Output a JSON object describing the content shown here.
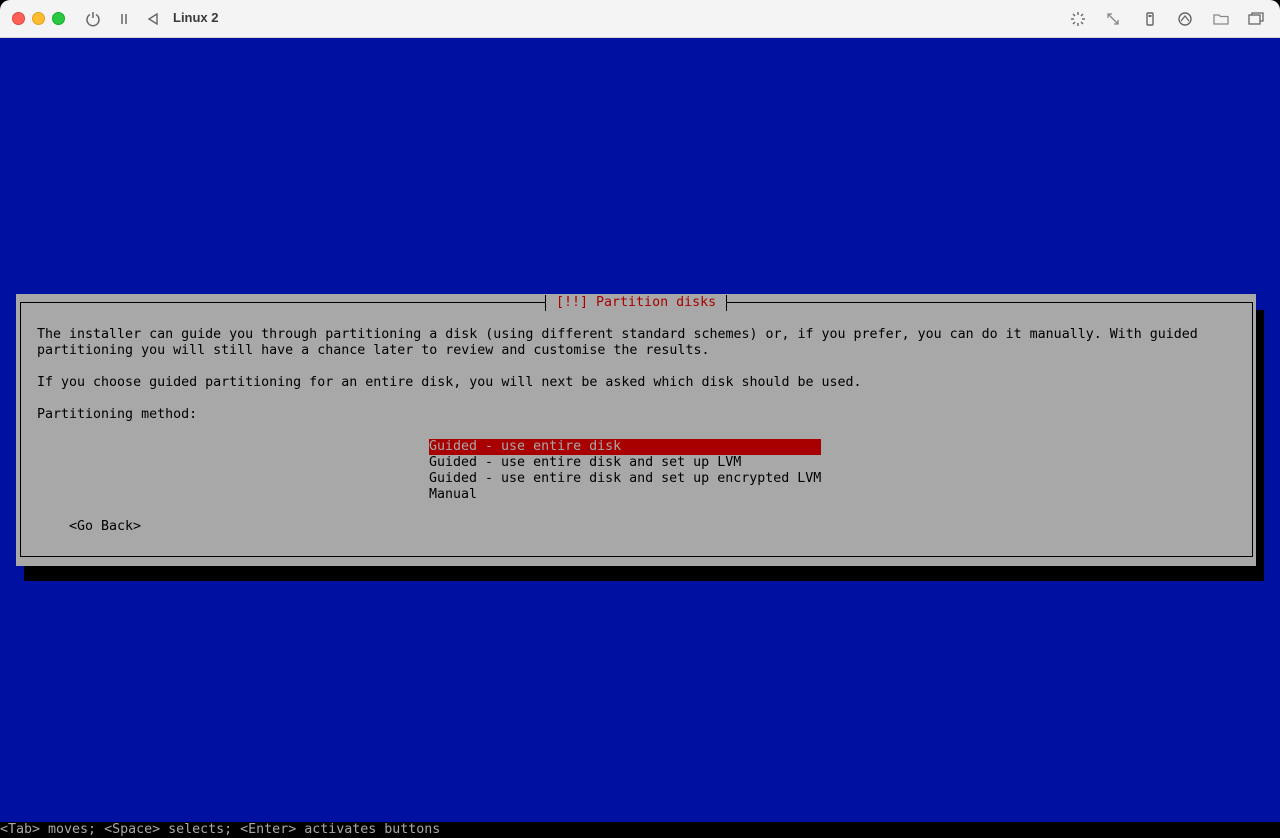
{
  "window": {
    "title": "Linux 2",
    "icons": [
      "power-icon",
      "pause-icon",
      "back-icon",
      "brightness-icon",
      "resize-icon",
      "usb-icon",
      "network-icon",
      "folder-icon",
      "windows-icon"
    ]
  },
  "dialog": {
    "title": "[!!] Partition disks",
    "paragraph1_line1": "The installer can guide you through partitioning a disk (using different standard schemes) or, if you prefer, you can do it manually. With guided",
    "paragraph1_line2": "partitioning you will still have a chance later to review and customise the results.",
    "paragraph2": "If you choose guided partitioning for an entire disk, you will next be asked which disk should be used.",
    "prompt": "Partitioning method:",
    "options": [
      "Guided - use entire disk",
      "Guided - use entire disk and set up LVM",
      "Guided - use entire disk and set up encrypted LVM",
      "Manual"
    ],
    "selected_index": 0,
    "go_back": "<Go Back>"
  },
  "statusbar": {
    "text": "<Tab> moves; <Space> selects; <Enter> activates buttons"
  },
  "colors": {
    "screen_bg": "#0010a0",
    "dialog_bg": "#a8a8a8",
    "accent": "#a80000"
  }
}
